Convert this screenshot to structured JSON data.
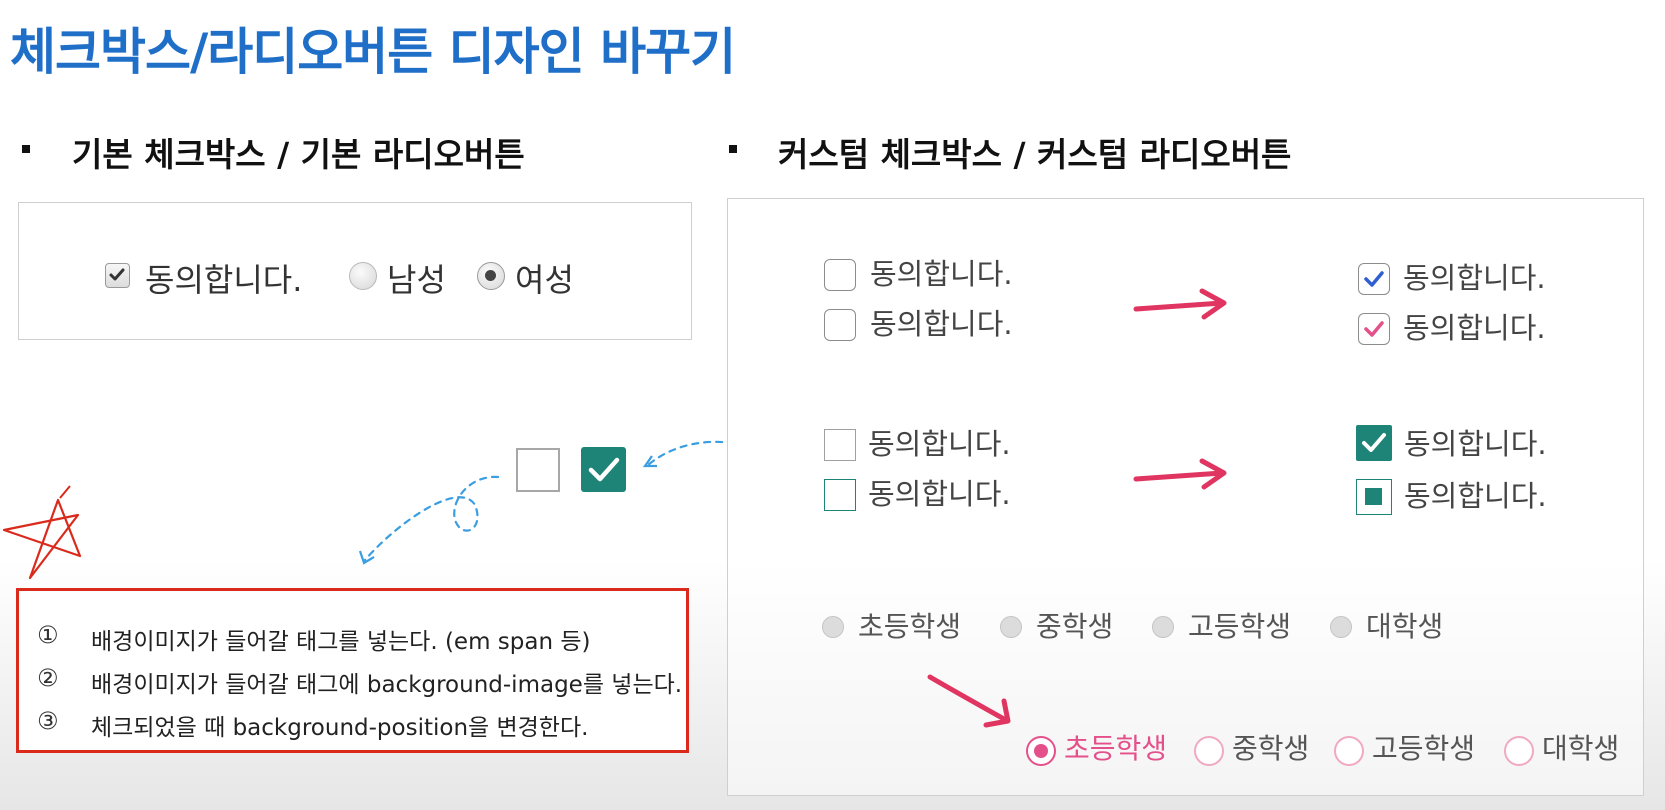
{
  "title": "체크박스/라디오버튼 디자인 바꾸기",
  "left_section": {
    "heading": "기본 체크박스 / 기본 라디오버튼",
    "basic_checkbox_label": "동의합니다.",
    "basic_radio_male": "남성",
    "basic_radio_female": "여성"
  },
  "right_section": {
    "heading": "커스텀 체크박스 / 커스텀 라디오버튼",
    "checkbox_label": "동의합니다.",
    "grade_options": [
      "초등학생",
      "중학생",
      "고등학생",
      "대학생"
    ]
  },
  "rules": [
    {
      "num": "①",
      "text": "배경이미지가 들어갈 태그를 넣는다. (em span 등)"
    },
    {
      "num": "②",
      "text": "배경이미지가 들어갈 태그에 background-image를 넣는다."
    },
    {
      "num": "③",
      "text": "체크되었을 때 background-position을 변경한다."
    }
  ],
  "colors": {
    "title_blue": "#1f6fc9",
    "teal": "#1e8478",
    "pink": "#e4508a",
    "arrow_red": "#e03560",
    "box_red": "#d92a1c",
    "dash_blue": "#3a9ee0"
  },
  "icons": [
    "checkmark-icon",
    "arrow-right-icon",
    "star-doodle-icon"
  ]
}
